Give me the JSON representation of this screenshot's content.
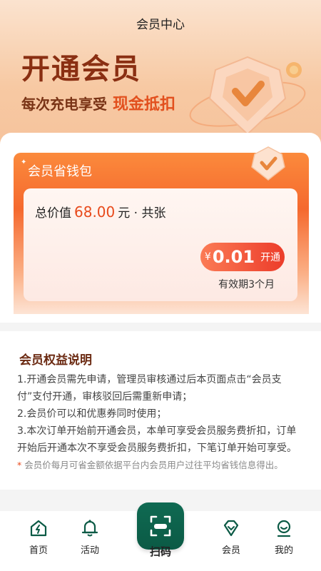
{
  "header": {
    "title": "会员中心"
  },
  "hero": {
    "title": "开通会员",
    "subtitle": "每次充电享受",
    "highlight": "现金抵扣"
  },
  "wallet": {
    "label": "会员省钱包",
    "total_prefix": "总价值",
    "total_amount": "68.00",
    "total_suffix": "元 · 共张",
    "currency": "¥",
    "price": "0.01",
    "button_label": "开通",
    "validity": "有效期3个月"
  },
  "rights": {
    "title": "会员权益说明",
    "items": [
      "1.开通会员需先申请，管理员审核通过后本页面点击“会员支付”支付开通，审核驳回后需重新申请；",
      "2.会员价可以和优惠券同时使用；",
      "3.本次订单开始前开通会员，本单可享受会员服务费折扣，订单开始后开通本次不享受会员服务费折扣，下笔订单开始可享受。"
    ],
    "note_mark": "*",
    "note": "会员价每月可省金额依据平台内会员用户过往平均省钱信息得出。"
  },
  "tabbar": {
    "home": "首页",
    "activity": "活动",
    "scan": "扫码",
    "member": "会员",
    "mine": "我的"
  },
  "colors": {
    "brand_green": "#0b5a45",
    "accent_orange": "#f5692e",
    "price_red": "#e84a1c"
  }
}
